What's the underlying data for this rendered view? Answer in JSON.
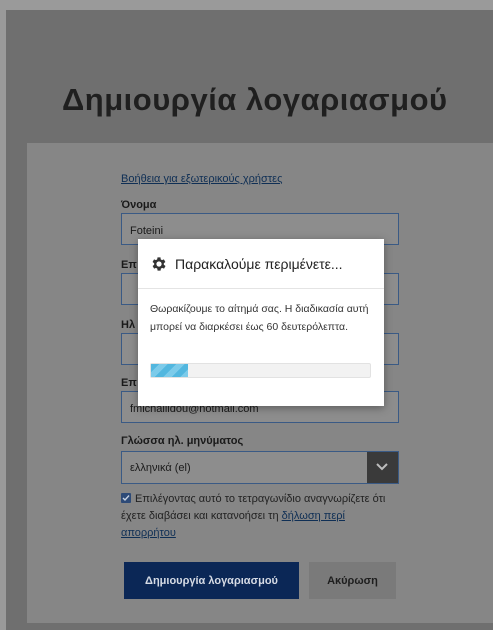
{
  "page": {
    "title": "Δημιουργία λογαριασμού"
  },
  "form": {
    "help_link": "Βοήθεια για εξωτερικούς χρήστες",
    "name_label": "Όνομα",
    "name_value": "Foteini",
    "field2_label_partial": "Επ",
    "field3_label_partial": "Ηλ",
    "field4_label_partial": "Επ",
    "email_value_partial": "fmichailidou@hotmail.com",
    "email_language_label": "Γλώσσα ηλ. μηνύματος",
    "email_language_value": "ελληνικά (el)",
    "consent_checked": true,
    "consent_text": "Επιλέγοντας αυτό το τετραγωνίδιο αναγνωρίζετε ότι έχετε διαβάσει και κατανοήσει τη",
    "privacy_link": "δήλωση περί απορρήτου",
    "create_button": "Δημιουργία λογαριασμού",
    "cancel_button": "Ακύρωση"
  },
  "modal": {
    "title": "Παρακαλούμε περιμένετε...",
    "message": "Θωρακίζουμε το αίτημά σας. Η διαδικασία αυτή μπορεί να διαρκέσει έως 60 δευτερόλεπτα.",
    "progress_fraction": 0.17,
    "icon": "gear-icon"
  },
  "colors": {
    "primary_button": "#0b2756",
    "progress": "#52b7df"
  }
}
